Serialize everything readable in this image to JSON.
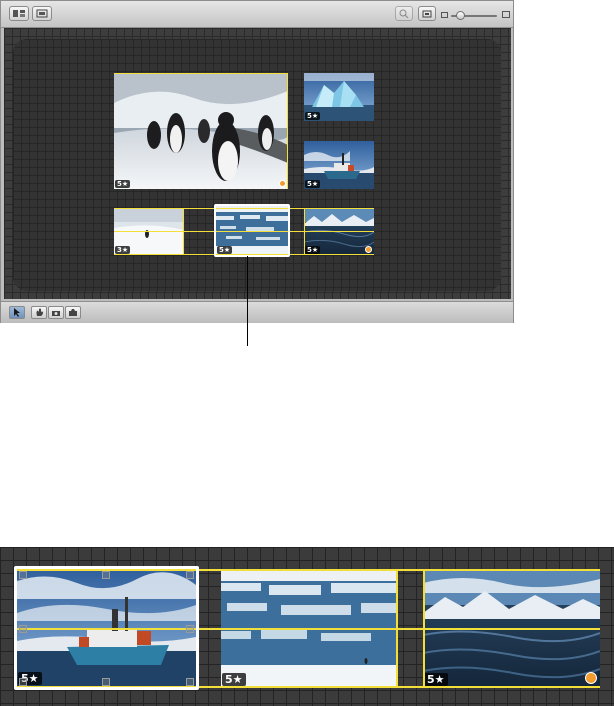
{
  "toolbar": {
    "left_buttons": [
      {
        "name": "layout-options-icon"
      },
      {
        "name": "view-options-icon"
      }
    ],
    "zoom": {
      "slider_fraction": 0.22
    }
  },
  "canvas": {
    "photos": [
      {
        "name": "penguins-photo",
        "subject": "penguins",
        "rating": "5★",
        "flag": true
      },
      {
        "name": "iceberg-photo",
        "subject": "iceberg",
        "rating": "5★",
        "flag": false
      },
      {
        "name": "ship-photo",
        "subject": "ship",
        "rating": "5★",
        "flag": false
      },
      {
        "name": "lone-penguin-photo",
        "subject": "lone penguin",
        "rating": "3★",
        "flag": false
      },
      {
        "name": "ice-floes-photo",
        "subject": "ice floes",
        "rating": "5★",
        "flag": false
      },
      {
        "name": "mountains-sea-photo",
        "subject": "mountains and sea",
        "rating": "5★",
        "flag": true
      }
    ]
  },
  "bottom_tools": [
    {
      "name": "pointer-tool-icon",
      "active": true
    },
    {
      "name": "hand-tool-icon",
      "active": false
    },
    {
      "name": "photo-swap-icon",
      "active": false
    },
    {
      "name": "photo-edit-icon",
      "active": false
    }
  ],
  "strip": {
    "photos": [
      {
        "name": "strip-ship-photo",
        "rating": "5★",
        "flag": false,
        "selected": true
      },
      {
        "name": "strip-ice-floes-photo",
        "rating": "5★",
        "flag": false,
        "selected": false
      },
      {
        "name": "strip-mountains-sea-photo",
        "rating": "5★",
        "flag": true,
        "selected": false
      }
    ]
  },
  "colors": {
    "guide": "#f2df3a",
    "selection": "#ffffff",
    "canvas": "#333333",
    "flag": "#f29b2e"
  }
}
